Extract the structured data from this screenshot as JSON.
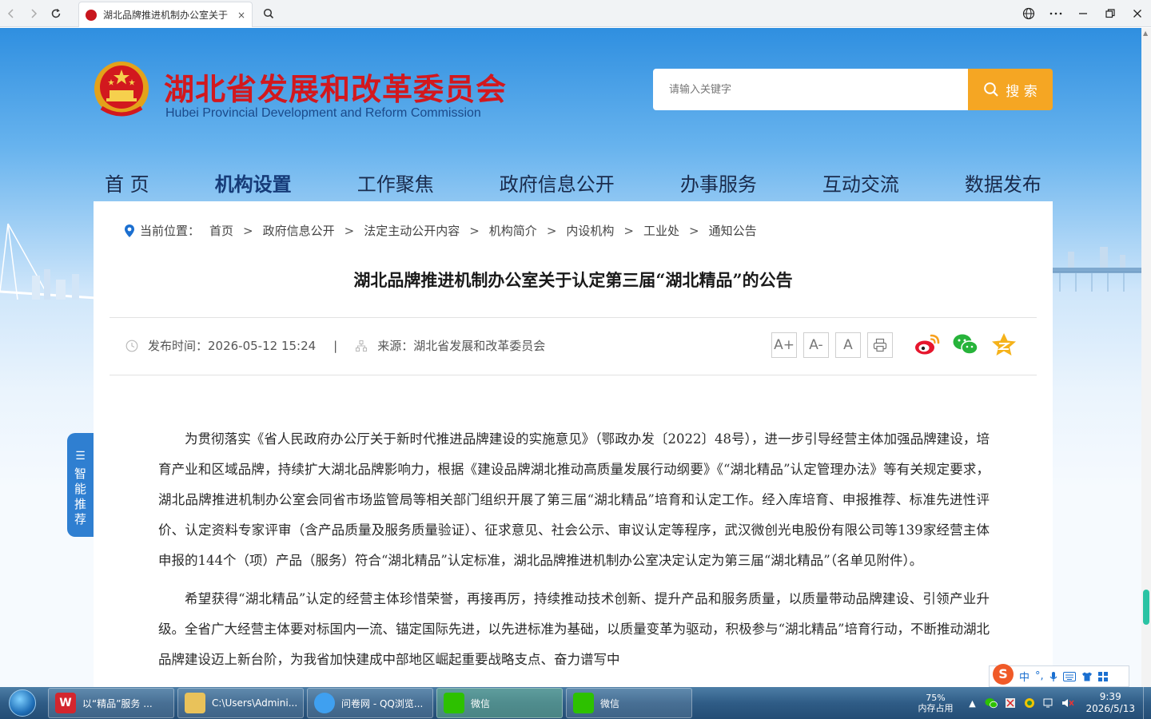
{
  "browser": {
    "tab_title": "湖北品牌推进机制办公室关于",
    "tab_close": "×"
  },
  "header": {
    "title": "湖北省发展和改革委员会",
    "subtitle": "Hubei Provincial Development and Reform Commission",
    "search_placeholder": "请输入关键字",
    "search_label": "搜 索"
  },
  "nav": {
    "items": [
      "首 页",
      "机构设置",
      "工作聚焦",
      "政府信息公开",
      "办事服务",
      "互动交流",
      "数据发布"
    ]
  },
  "breadcrumb": {
    "label": "当前位置：",
    "items": [
      "首页",
      "政府信息公开",
      "法定主动公开内容",
      "机构简介",
      "内设机构",
      "工业处",
      "通知公告"
    ],
    "separator": ">"
  },
  "article": {
    "title": "湖北品牌推进机制办公室关于认定第三届“湖北精品”的公告",
    "publish_time": "发布时间：2026-05-12 15:24",
    "divider": "|",
    "source": "来源：湖北省发展和改革委员会",
    "font_buttons": [
      "A+",
      "A-",
      "A"
    ],
    "paragraphs": [
      "为贯彻落实《省人民政府办公厅关于新时代推进品牌建设的实施意见》（鄂政办发〔2022〕48号），进一步引导经营主体加强品牌建设，培育产业和区域品牌，持续扩大湖北品牌影响力，根据《建设品牌湖北推动高质量发展行动纲要》《“湖北精品”认定管理办法》等有关规定要求，湖北品牌推进机制办公室会同省市场监管局等相关部门组织开展了第三届“湖北精品”培育和认定工作。经入库培育、申报推荐、标准先进性评价、认定资料专家评审（含产品质量及服务质量验证）、征求意见、社会公示、审议认定等程序，武汉微创光电股份有限公司等139家经营主体申报的144个（项）产品（服务）符合“湖北精品”认定标准，湖北品牌推进机制办公室决定认定为第三届“湖北精品”（名单见附件）。",
      "希望获得“湖北精品”认定的经营主体珍惜荣誉，再接再厉，持续推动技术创新、提升产品和服务质量，以质量带动品牌建设、引领产业升级。全省广大经营主体要对标国内一流、锚定国际先进，以先进标准为基础，以质量变革为驱动，积极参与“湖北精品”培育行动，不断推动湖北品牌建设迈上新台阶，为我省加快建成中部地区崛起重要战略支点、奋力谱写中"
    ]
  },
  "side_float": {
    "label": [
      "智",
      "能",
      "推",
      "荐"
    ]
  },
  "ime": {
    "mode": "中"
  },
  "taskbar": {
    "items": [
      {
        "label": "以“精品”服务 ..."
      },
      {
        "label": "C:\\Users\\Admini..."
      },
      {
        "label": "问卷网 - QQ浏览..."
      },
      {
        "label": "微信"
      },
      {
        "label": "微信"
      }
    ],
    "memory_percent": "75%",
    "memory_label": "内存占用",
    "time": "9:39",
    "date": "2026/5/13"
  },
  "colors": {
    "brand_red": "#d2181e",
    "search_orange": "#f5a623",
    "nav_text": "#1a2b4c",
    "side_blue": "#2f7fd1"
  }
}
